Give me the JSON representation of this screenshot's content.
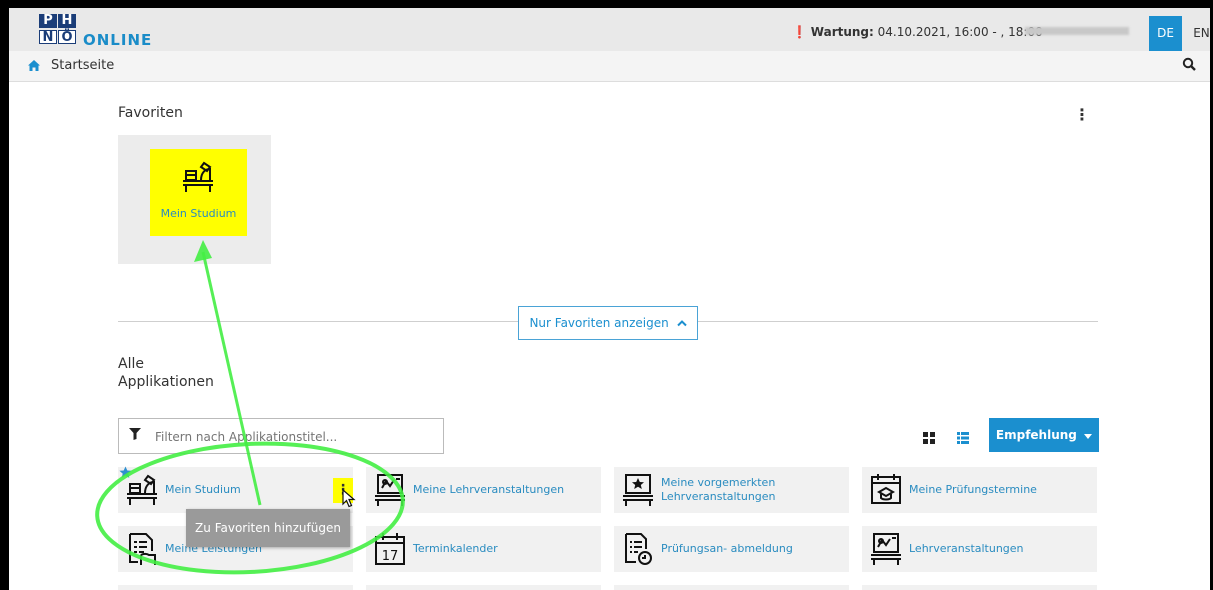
{
  "header": {
    "logo_letters": [
      "P",
      "H",
      "N",
      "Ö"
    ],
    "logo_text": "ONLINE",
    "maintenance_label": "Wartung:",
    "maintenance_value": "04.10.2021, 16:00 - , 18:00",
    "lang_de": "DE",
    "lang_en": "EN"
  },
  "nav": {
    "breadcrumb": "Startseite"
  },
  "favorites": {
    "title": "Favoriten",
    "menu": "⋮",
    "tile_label": "Mein Studium"
  },
  "toggle_favorites": "Nur Favoriten anzeigen",
  "all_apps": {
    "title": "Alle Applikationen",
    "filter_placeholder": "Filtern nach Applikationstitel...",
    "sort_button": "Empfehlung",
    "items": [
      {
        "label": "Mein Studium",
        "icon": "desk-icon"
      },
      {
        "label": "Meine Lehrveranstaltungen",
        "icon": "whiteboard-desk-icon"
      },
      {
        "label": "Meine vorgemerkten Lehrveranstaltungen",
        "icon": "star-desk-icon"
      },
      {
        "label": "Meine Prüfungstermine",
        "icon": "exam-calendar-icon"
      },
      {
        "label": "Meine Leistungen",
        "icon": "document-hand-icon"
      },
      {
        "label": "Terminkalender",
        "icon": "calendar-icon"
      },
      {
        "label": "Prüfungsan- abmeldung",
        "icon": "document-clock-icon"
      },
      {
        "label": "Lehrveranstaltungen",
        "icon": "whiteboard-desk-icon"
      }
    ],
    "item_menu": "⋮",
    "calendar_day": "17"
  },
  "tooltip": "Zu Favoriten hinzufügen",
  "colors": {
    "accent": "#1b8fcf",
    "highlight": "#ffff00",
    "annotation": "#44ee44"
  }
}
